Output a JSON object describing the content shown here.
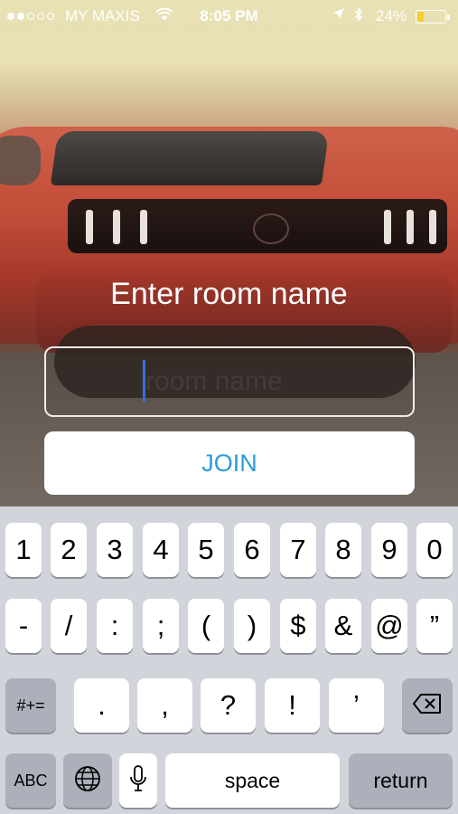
{
  "status_bar": {
    "carrier": "MY MAXIS",
    "time": "8:05 PM",
    "battery_percent": "24%",
    "battery_level": 0.24,
    "icons": [
      "signal-dots",
      "wifi-icon",
      "location-arrow-icon",
      "bluetooth-icon",
      "battery-icon"
    ]
  },
  "screen": {
    "title": "Enter room name",
    "input": {
      "placeholder": "room name",
      "value": ""
    },
    "join_label": "JOIN"
  },
  "keyboard": {
    "row1": [
      "1",
      "2",
      "3",
      "4",
      "5",
      "6",
      "7",
      "8",
      "9",
      "0"
    ],
    "row2": [
      "-",
      "/",
      ":",
      ";",
      "(",
      ")",
      "$",
      "&",
      "@",
      "”"
    ],
    "row3": [
      ".",
      ",",
      "?",
      "!",
      "’"
    ],
    "symbols_label": "#+=",
    "abc_label": "ABC",
    "space_label": "space",
    "return_label": "return",
    "icons": [
      "globe-icon",
      "microphone-icon",
      "backspace-icon"
    ]
  }
}
